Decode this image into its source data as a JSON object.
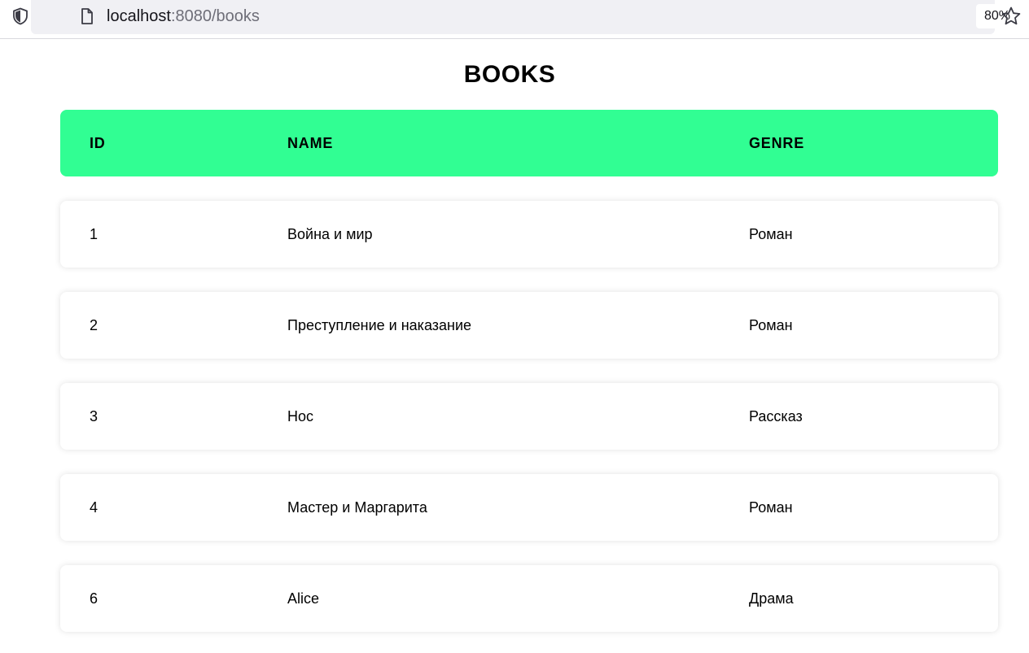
{
  "browser": {
    "url_host": "localhost",
    "url_rest": ":8080/books",
    "zoom": "80%"
  },
  "page": {
    "title": "BOOKS"
  },
  "table": {
    "headers": {
      "id": "ID",
      "name": "NAME",
      "genre": "GENRE"
    },
    "rows": [
      {
        "id": "1",
        "name": "Война и мир",
        "genre": "Роман"
      },
      {
        "id": "2",
        "name": "Преступление и наказание",
        "genre": "Роман"
      },
      {
        "id": "3",
        "name": "Нос",
        "genre": "Рассказ"
      },
      {
        "id": "4",
        "name": "Мастер и Маргарита",
        "genre": "Роман"
      },
      {
        "id": "6",
        "name": "Alice",
        "genre": "Драма"
      }
    ]
  },
  "colors": {
    "header_bg": "#31fe93",
    "url_field_bg": "#f0f0f4"
  }
}
